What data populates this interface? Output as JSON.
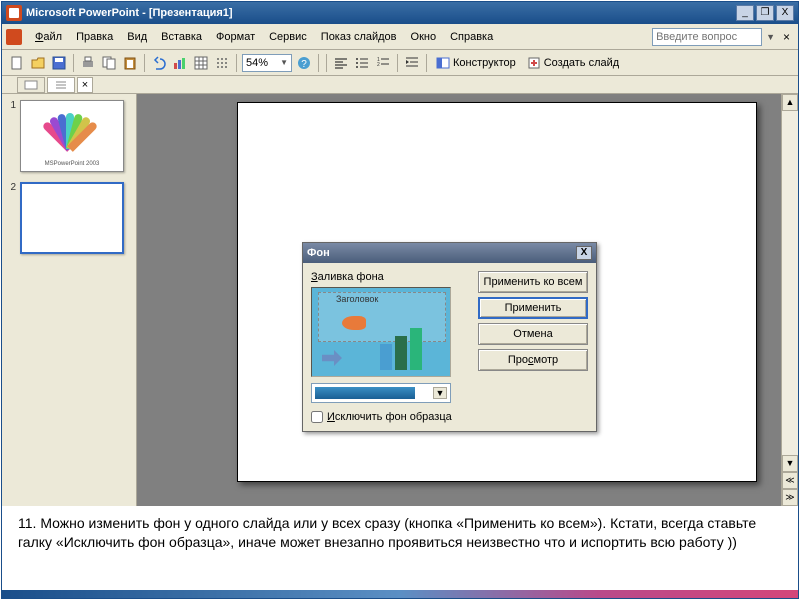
{
  "titlebar": {
    "title": "Microsoft PowerPoint - [Презентация1]",
    "min": "_",
    "restore": "❐",
    "close": "X"
  },
  "menu": {
    "file": "Файл",
    "edit": "Правка",
    "view": "Вид",
    "insert": "Вставка",
    "format": "Формат",
    "tools": "Сервис",
    "slideshow": "Показ слайдов",
    "window": "Окно",
    "help": "Справка",
    "question_placeholder": "Введите вопрос",
    "mdi_min": "_",
    "mdi_restore": "❐",
    "mdi_close": "×"
  },
  "toolbar": {
    "zoom": "54%",
    "designer": "Конструктор",
    "new_slide": "Создать слайд"
  },
  "thumbs": {
    "n1": "1",
    "n2": "2",
    "slide1_caption": "MSPowerPoint 2003"
  },
  "dialog": {
    "title": "Фон",
    "fill_label": "Заливка фона",
    "preview_title": "Заголовок",
    "exclude_master": "Исключить фон образца",
    "apply_all": "Применить ко всем",
    "apply": "Применить",
    "cancel": "Отмена",
    "preview_btn": "Просмотр",
    "close_x": "X"
  },
  "caption": {
    "text": "11.   Можно изменить фон у одного слайда или у всех сразу (кнопка «Применить ко всем»). Кстати, всегда ставьте галку «Исключить фон образца», иначе может внезапно проявиться неизвестно что и испортить всю работу ))"
  },
  "colors": {
    "fan": [
      "#e64a8c",
      "#9a4ad1",
      "#4a6ed1",
      "#4ad1c4",
      "#6ed14a",
      "#d1c44a",
      "#e68c4a"
    ]
  }
}
